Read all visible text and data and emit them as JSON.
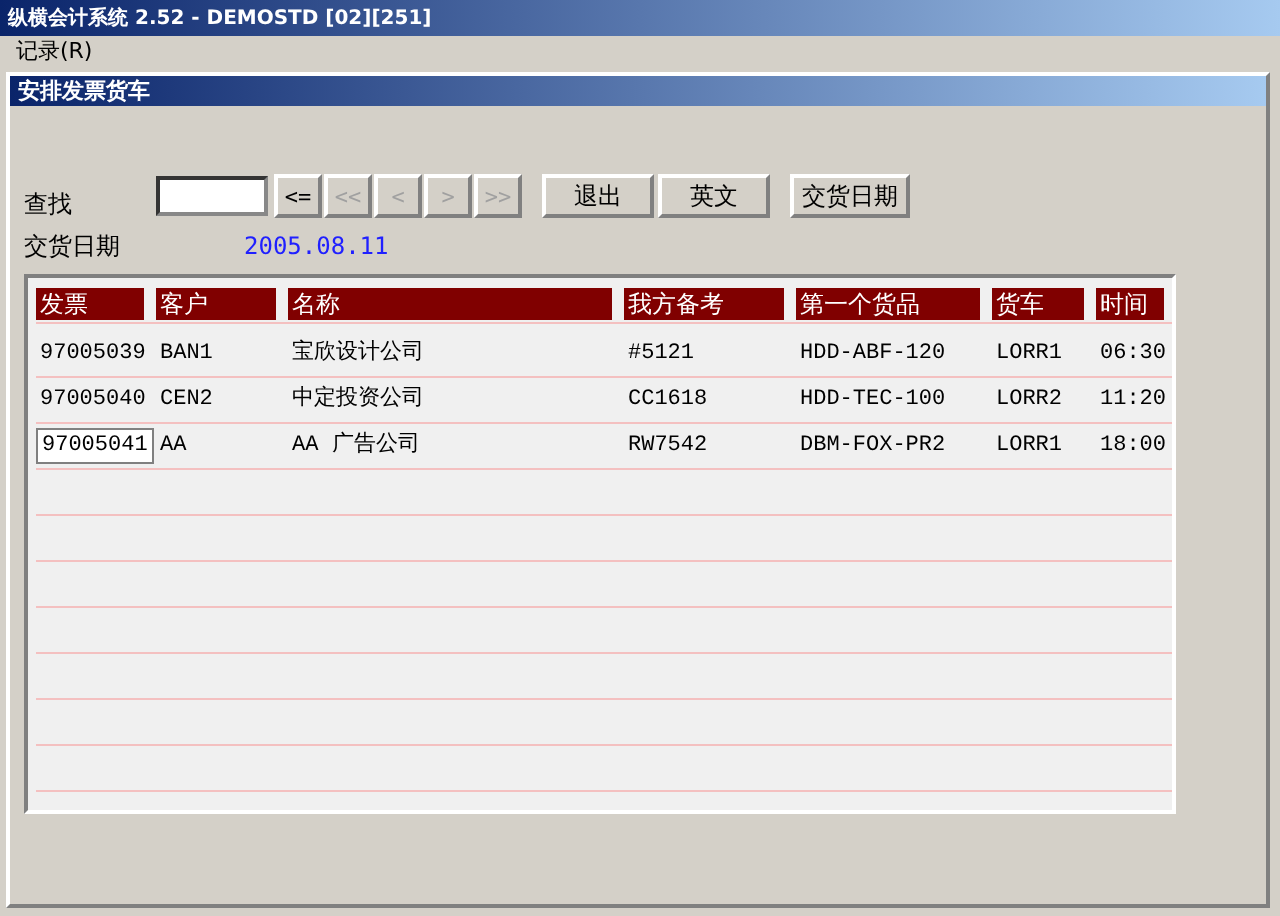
{
  "window": {
    "title": "纵横会计系统 2.52 - DEMOSTD [02][251]"
  },
  "menu": [
    {
      "label": "记录(R)"
    }
  ],
  "child_window": {
    "title": "安排发票货车"
  },
  "search": {
    "label": "查找"
  },
  "nav_buttons": [
    {
      "label": "<=",
      "disabled": false
    },
    {
      "label": "<<",
      "disabled": true
    },
    {
      "label": "<",
      "disabled": true
    },
    {
      "label": ">",
      "disabled": true
    },
    {
      "label": ">>",
      "disabled": true
    }
  ],
  "buttons": [
    {
      "label": "退出"
    },
    {
      "label": "英文"
    },
    {
      "label": "交货日期"
    }
  ],
  "delivery_date": {
    "label": "交货日期",
    "value": "2005.08.11"
  },
  "table": {
    "columns": [
      "发票",
      "客户",
      "名称",
      "我方备考",
      "第一个货品",
      "货车",
      "时间"
    ],
    "rows": [
      {
        "selected": false,
        "cells": [
          "97005039",
          "BAN1",
          "宝欣设计公司",
          "#5121",
          "HDD-ABF-120",
          "LORR1",
          "06:30"
        ]
      },
      {
        "selected": false,
        "cells": [
          "97005040",
          "CEN2",
          "中定投资公司",
          "CC1618",
          "HDD-TEC-100",
          "LORR2",
          "11:20"
        ]
      },
      {
        "selected": true,
        "cells": [
          "97005041",
          "AA",
          "AA 广告公司",
          "RW7542",
          "DBM-FOX-PR2",
          "LORR1",
          "18:00"
        ]
      }
    ]
  }
}
